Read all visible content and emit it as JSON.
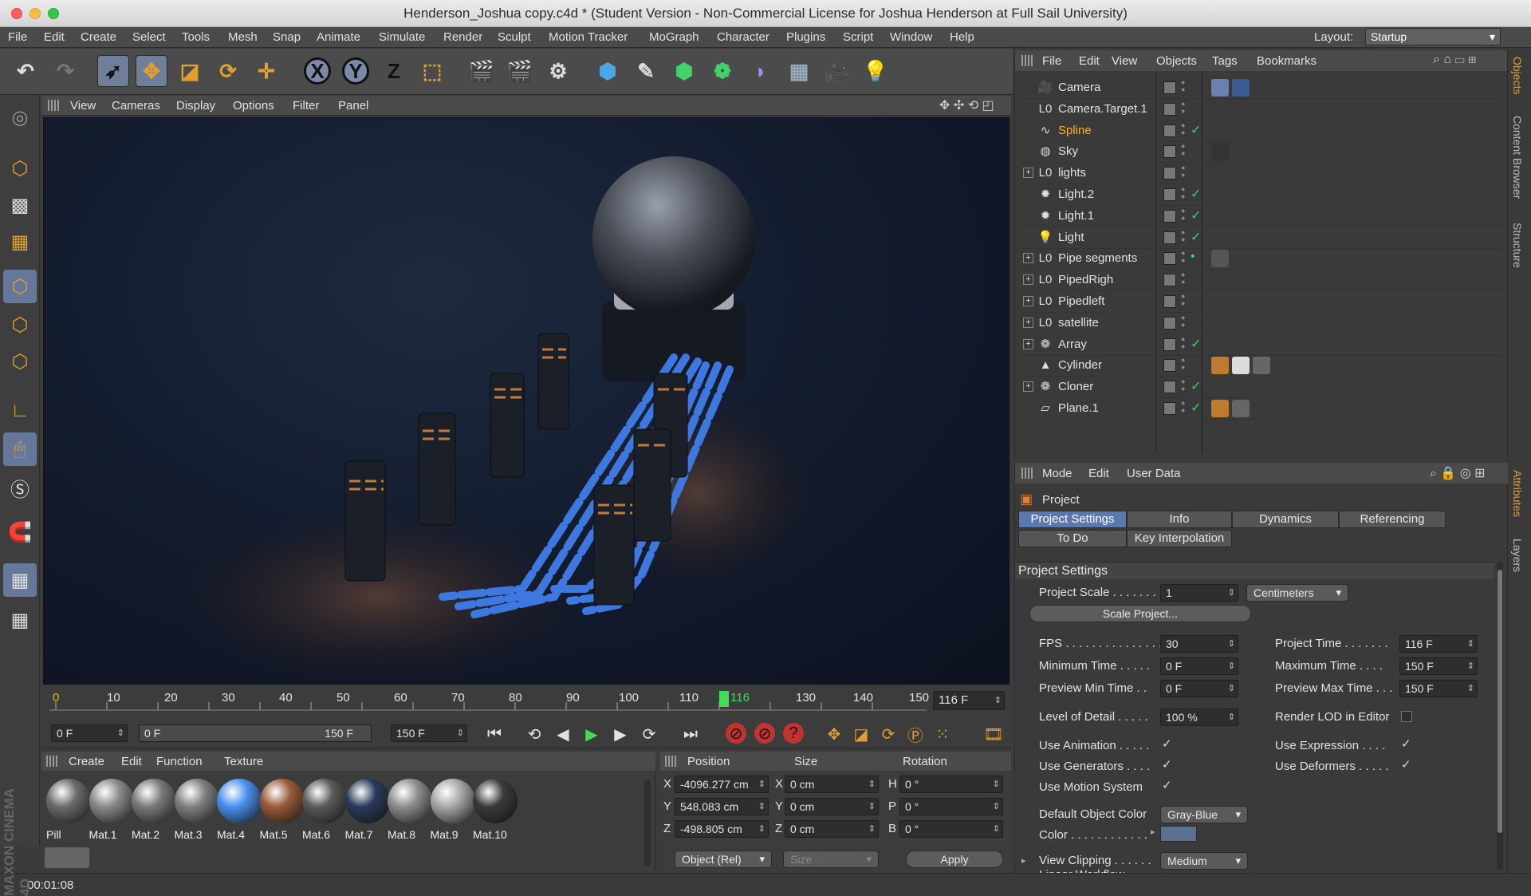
{
  "window": {
    "title": "Henderson_Joshua copy.c4d * (Student Version - Non-Commercial License for Joshua Henderson at Full Sail University)"
  },
  "menu": [
    "File",
    "Edit",
    "Create",
    "Select",
    "Tools",
    "Mesh",
    "Snap",
    "Animate",
    "Simulate",
    "Render",
    "Sculpt",
    "Motion Tracker",
    "MoGraph",
    "Character",
    "Plugins",
    "Script",
    "Window",
    "Help"
  ],
  "layout": {
    "label": "Layout:",
    "value": "Startup"
  },
  "toolbar": {
    "axis_x": "X",
    "axis_y": "Y",
    "axis_z": "Z"
  },
  "viewport": {
    "menu": [
      "View",
      "Cameras",
      "Display",
      "Options",
      "Filter",
      "Panel"
    ]
  },
  "timeline": {
    "ticks": [
      "0",
      "10",
      "20",
      "30",
      "40",
      "50",
      "60",
      "70",
      "80",
      "90",
      "100",
      "110",
      "116",
      "130",
      "140",
      "150"
    ],
    "current_frame": "116 F"
  },
  "transport": {
    "start": "0 F",
    "range_start": "0 F",
    "range_end": "150 F",
    "end": "150 F"
  },
  "materials": {
    "menu": [
      "Create",
      "Edit",
      "Function",
      "Texture"
    ],
    "items": [
      {
        "name": "Pill",
        "color": "#6b6b6b"
      },
      {
        "name": "Mat.1",
        "color": "#8a8a8a"
      },
      {
        "name": "Mat.2",
        "color": "#7a7a7a"
      },
      {
        "name": "Mat.3",
        "color": "#808080"
      },
      {
        "name": "Mat.4",
        "color": "#4a90f0"
      },
      {
        "name": "Mat.5",
        "color": "#9a5a3a"
      },
      {
        "name": "Mat.6",
        "color": "#5a5a5a"
      },
      {
        "name": "Mat.7",
        "color": "#2a3a5a"
      },
      {
        "name": "Mat.8",
        "color": "#8e8e8e"
      },
      {
        "name": "Mat.9",
        "color": "#a8a8a8"
      },
      {
        "name": "Mat.10",
        "color": "#3a3a3a"
      }
    ]
  },
  "coords": {
    "headers": {
      "position": "Position",
      "size": "Size",
      "rotation": "Rotation"
    },
    "rows": [
      {
        "axis": "X",
        "pos": "-4096.277 cm",
        "saxis": "X",
        "size": "0 cm",
        "raxis": "H",
        "rot": "0 °"
      },
      {
        "axis": "Y",
        "pos": "548.083 cm",
        "saxis": "Y",
        "size": "0 cm",
        "raxis": "P",
        "rot": "0 °"
      },
      {
        "axis": "Z",
        "pos": "-498.805 cm",
        "saxis": "Z",
        "size": "0 cm",
        "raxis": "B",
        "rot": "0 °"
      }
    ],
    "mode": "Object (Rel)",
    "size_mode": "Size",
    "apply": "Apply"
  },
  "status": {
    "time": "00:01:08"
  },
  "objects": {
    "menu": [
      "File",
      "Edit",
      "View",
      "Objects",
      "Tags",
      "Bookmarks"
    ],
    "rows": [
      {
        "name": "Camera",
        "icon": "camera-icon",
        "glyph": "🎥",
        "exp": "",
        "check": "",
        "selected": false
      },
      {
        "name": "Camera.Target.1",
        "icon": "null-icon",
        "glyph": "L0",
        "exp": "",
        "check": "",
        "selected": false
      },
      {
        "name": "Spline",
        "icon": "spline-icon",
        "glyph": "∿",
        "exp": "",
        "check": "✓",
        "selected": true
      },
      {
        "name": "Sky",
        "icon": "sky-icon",
        "glyph": "◍",
        "exp": "",
        "check": "",
        "selected": false
      },
      {
        "name": "lights",
        "icon": "null-icon",
        "glyph": "L0",
        "exp": "+",
        "check": "",
        "selected": false
      },
      {
        "name": "Light.2",
        "icon": "light-icon",
        "glyph": "✹",
        "exp": "",
        "check": "✓",
        "selected": false
      },
      {
        "name": "Light.1",
        "icon": "light-icon",
        "glyph": "✹",
        "exp": "",
        "check": "✓",
        "selected": false
      },
      {
        "name": "Light",
        "icon": "bulb-icon",
        "glyph": "💡",
        "exp": "",
        "check": "✓",
        "selected": false
      },
      {
        "name": "Pipe segments",
        "icon": "null-icon",
        "glyph": "L0",
        "exp": "+",
        "check": "•",
        "selected": false
      },
      {
        "name": "PipedRigh",
        "icon": "null-icon",
        "glyph": "L0",
        "exp": "+",
        "check": "",
        "selected": false
      },
      {
        "name": "Pipedleft",
        "icon": "null-icon",
        "glyph": "L0",
        "exp": "+",
        "check": "",
        "selected": false
      },
      {
        "name": "satellite",
        "icon": "null-icon",
        "glyph": "L0",
        "exp": "+",
        "check": "",
        "selected": false
      },
      {
        "name": "Array",
        "icon": "array-icon",
        "glyph": "❁",
        "exp": "+",
        "check": "✓",
        "selected": false
      },
      {
        "name": "Cylinder",
        "icon": "cylinder-icon",
        "glyph": "▲",
        "exp": "",
        "check": "",
        "selected": false
      },
      {
        "name": "Cloner",
        "icon": "cloner-icon",
        "glyph": "❁",
        "exp": "+",
        "check": "✓",
        "selected": false
      },
      {
        "name": "Plane.1",
        "icon": "plane-icon",
        "glyph": "▱",
        "exp": "",
        "check": "✓",
        "selected": false
      }
    ]
  },
  "side_tabs": [
    "Objects",
    "Content Browser",
    "Structure",
    "Attributes",
    "Layers"
  ],
  "attributes": {
    "menu": [
      "Mode",
      "Edit",
      "User Data"
    ],
    "object": "Project",
    "tabs": [
      "Project Settings",
      "Info",
      "Dynamics",
      "Referencing",
      "To Do",
      "Key Interpolation"
    ],
    "section": "Project Settings",
    "project_scale": {
      "label": "Project Scale . . . . . . .",
      "value": "1",
      "unit": "Centimeters"
    },
    "scale_button": "Scale Project...",
    "fps": {
      "label": "FPS . . . . . . . . . . . . . . . .",
      "value": "30"
    },
    "project_time": {
      "label": "Project Time . . . . . . .",
      "value": "116 F"
    },
    "min_time": {
      "label": "Minimum Time . . . . .",
      "value": "0 F"
    },
    "max_time": {
      "label": "Maximum Time . . . .",
      "value": "150 F"
    },
    "prev_min": {
      "label": "Preview Min Time . .",
      "value": "0 F"
    },
    "prev_max": {
      "label": "Preview Max Time . . .",
      "value": "150 F"
    },
    "lod": {
      "label": "Level of Detail . . . . .",
      "value": "100 %"
    },
    "render_lod": "Render LOD in Editor",
    "use_animation": "Use Animation . . . . .",
    "use_expression": "Use Expression . . . .",
    "use_generators": "Use Generators . . . .",
    "use_deformers": "Use Deformers . . . . .",
    "use_motion": "Use Motion System",
    "default_color": {
      "label": "Default Object Color",
      "value": "Gray-Blue"
    },
    "color": {
      "label": "Color . . . . . . . . . . . .",
      "swatch": "#5b6f8f"
    },
    "view_clipping": {
      "label": "View Clipping . . . . . .",
      "value": "Medium"
    },
    "linear_workflow": "Linear Workflow . . . . ."
  }
}
